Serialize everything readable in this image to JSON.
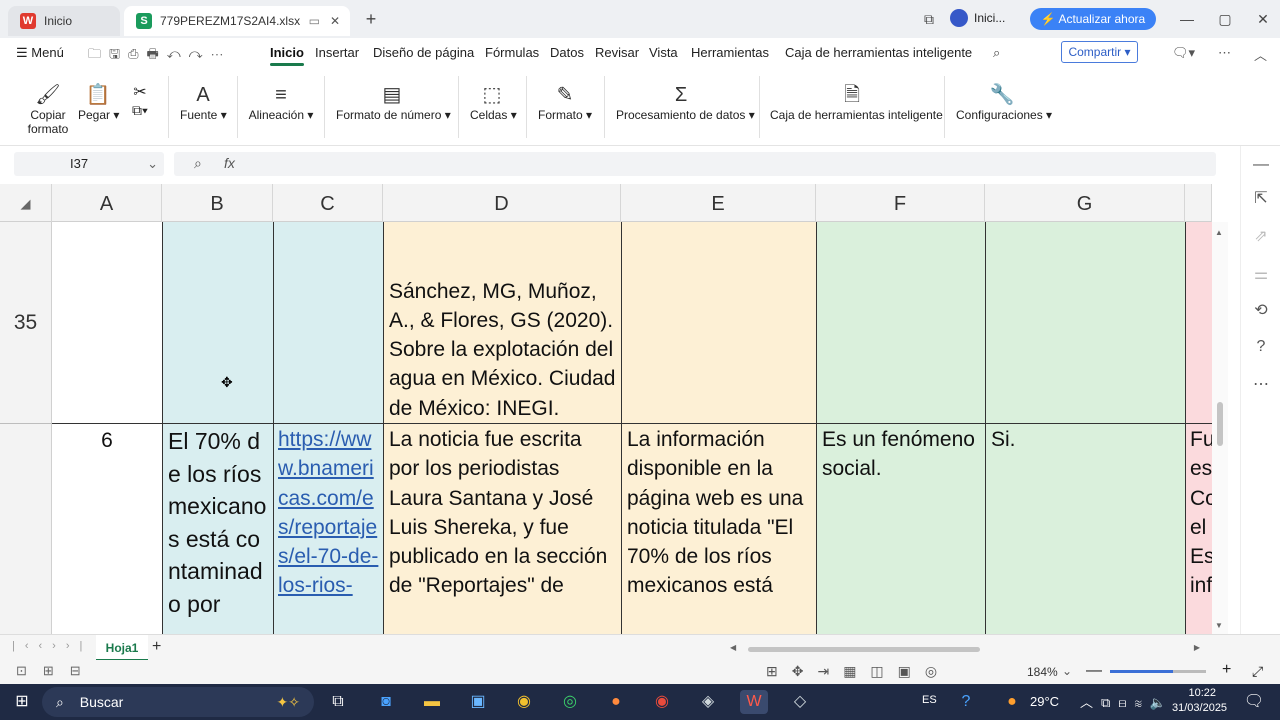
{
  "tabs": {
    "home": "Inicio",
    "file": "779PEREZM17S2AI4.xlsx"
  },
  "account": {
    "label": "Inici...",
    "upgrade": "Actualizar ahora"
  },
  "menu": {
    "menu_label": "Menú",
    "items": [
      "Inicio",
      "Insertar",
      "Diseño de página",
      "Fórmulas",
      "Datos",
      "Revisar",
      "Vista",
      "Herramientas",
      "Caja de herramientas inteligente"
    ],
    "share": "Compartir"
  },
  "ribbon": {
    "copy_format": "Copiar formato",
    "paste": "Pegar",
    "font": "Fuente",
    "align": "Alineación",
    "number_format": "Formato de número",
    "cells": "Celdas",
    "format": "Formato",
    "data_processing": "Procesamiento de datos",
    "smart_toolbox": "Caja de herramientas inteligente",
    "settings": "Configuraciones"
  },
  "formula_bar": {
    "name_box": "I37",
    "formula": ""
  },
  "columns": [
    "A",
    "B",
    "C",
    "D",
    "E",
    "F",
    "G"
  ],
  "rows": [
    {
      "num": "35",
      "A": "",
      "B": "",
      "C": "",
      "D": "Sánchez, MG, Muñoz, A., & Flores, GS (2020). Sobre la explotación del agua en México. Ciudad de México: INEGI.",
      "E": "",
      "F": "",
      "G": "",
      "H": ""
    },
    {
      "num": "",
      "A": "6",
      "B": "El 70% de los ríos mexicanos está contaminado por",
      "C": "https://www.bnamericas.com/es/reportajes/el-70-de-los-rios-",
      "D": "La noticia fue escrita por los periodistas Laura Santana y José Luis Shereka, y fue publicado en la sección de \"Reportajes\" de",
      "E": "La información disponible en la página web es una noticia titulada \"El 70% de los ríos mexicanos está",
      "F": "Es un fenómeno social.",
      "G": "Si.",
      "H": "Fu es Co el Es inf"
    }
  ],
  "sheet_tab": "Hoja1",
  "zoom": "184%",
  "taskbar": {
    "search": "Buscar",
    "lang": "ES",
    "temp": "29°C",
    "time": "10:22",
    "date": "31/03/2025"
  },
  "colors": {
    "blue_cell": "#d9eef0",
    "yellow_cell": "#fdf0d5",
    "green_cell": "#daf0dc",
    "pink_cell": "#fbdadd",
    "accent": "#1a7a4c"
  }
}
